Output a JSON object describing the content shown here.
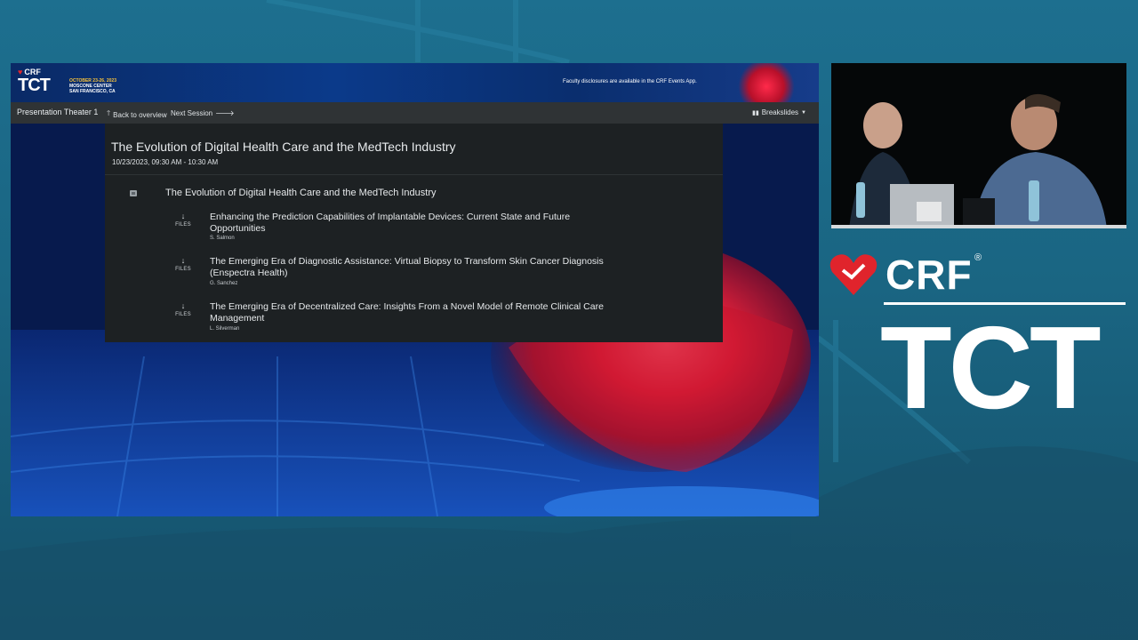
{
  "slide": {
    "header": {
      "crf": "CRF",
      "tct": "TCT",
      "dates": "OCTOBER 23-26, 2023",
      "venue": "MOSCONE CENTER",
      "city": "SAN FRANCISCO, CA",
      "disclosure": "Faculty disclosures are available in the CRF Events App."
    },
    "toolbar": {
      "theater": "Presentation Theater 1",
      "back": "Back to overview",
      "next": "Next Session",
      "breakslides": "Breakslides"
    },
    "session": {
      "title": "The Evolution of Digital Health Care and the MedTech Industry",
      "time": "10/23/2023, 09:30 AM - 10:30 AM",
      "section_title": "The Evolution of Digital Health Care and the MedTech Industry",
      "files_label": "FILES",
      "talks": [
        {
          "title": "Enhancing the Prediction Capabilities of Implantable Devices: Current State and Future Opportunities",
          "author": "S. Salmon"
        },
        {
          "title": "The Emerging Era of Diagnostic Assistance: Virtual Biopsy to Transform Skin Cancer Diagnosis (Enspectra Health)",
          "author": "G. Sanchez"
        },
        {
          "title": "The Emerging Era of Decentralized Care: Insights From a Novel Model of Remote Clinical Care Management",
          "author": "L. Silverman"
        }
      ]
    }
  },
  "brand": {
    "crf": "CRF",
    "registered": "®",
    "tct": "TCT"
  },
  "colors": {
    "background": "#1a6582",
    "panel": "#1d2123",
    "toolbar": "#2f3335",
    "crf_red": "#e0242c",
    "date_gold": "#f7c23b"
  },
  "icons": {
    "files": "download-arrow-icon",
    "section": "list-icon",
    "back": "arrow-up-icon",
    "next": "arrow-right-icon",
    "breakslides": "pause-icon",
    "dropdown": "caret-down-icon"
  }
}
